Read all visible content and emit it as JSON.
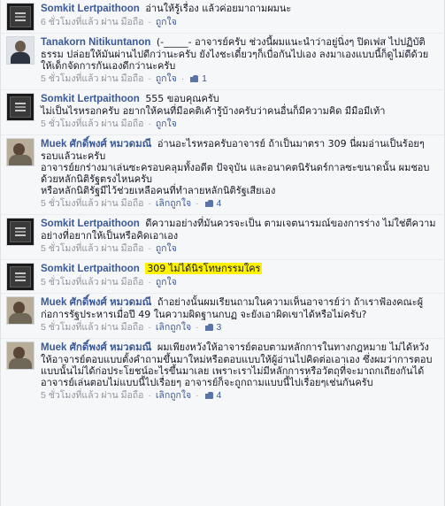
{
  "comments": [
    {
      "author": "Somkit Lertpaithoon",
      "avatar": "somkit",
      "text": "อ่านให้รู้เรื่อง แล้วค่อยมาถามผมนะ",
      "time": "6 ชั่วโมงที่แล้ว",
      "via": "ผ่าน มือถือ",
      "action": "ถูกใจ",
      "likes": "",
      "highlight": false
    },
    {
      "author": "Tanakorn Nitikuntanon",
      "avatar": "tanakorn",
      "text": "(-_____- อาจารย์ครับ ช่วงนี้ผมแนะนำว่าอยู่นิ่งๆ ปิดเฟส ไปปฏิบัติธรรม ปล่อยให้มันผ่านไปดีกว่านะครับ ยังไงชะเดี๋ยวๆก็เบื่อกันไปเอง ลงมาเองแบบนี้ก็ดูไม่ดีด้วย ให้เด็กจัดการกันเองดีกว่านะครับ",
      "time": "5 ชั่วโมงที่แล้ว",
      "via": "ผ่าน มือถือ",
      "action": "ถูกใจ",
      "likes": "1",
      "highlight": false
    },
    {
      "author": "Somkit Lertpaithoon",
      "avatar": "somkit",
      "text": "555 ขอบคุณครับ\nไม่เป็นไรหรอกครับ อยากให้คนที่มีอคติเค้ารู้บ้างครับว่าคนอื่นก็มีความคิด มีมือมีเท้า",
      "time": "5 ชั่วโมงที่แล้ว",
      "via": "ผ่าน มือถือ",
      "action": "ถูกใจ",
      "likes": "",
      "highlight": false
    },
    {
      "author": "Muek ศักดิ์พงศ์ หมวดมณี",
      "avatar": "muek",
      "text": "อ่านอะไรหรอครับอาจารย์ ถ้าเป็นมาตรา 309 นี่ผมอ่านเป็นร้อยๆรอบแล้วนะครับ\nอาจารย์ยกร่างมาเล่นซะครอบคลุมทั้งอดีต ปัจจุบัน และอนาคตนิรันดร์กาลซะขนาดนั้น ผมชอบด้วยหลักนิติรัฐตรงไหนครับ\nหรือหลักนิติรัฐมีไว้ช่วยเหลือคนที่ทำลายหลักนิติรัฐเสียเอง",
      "time": "5 ชั่วโมงที่แล้ว",
      "via": "ผ่าน มือถือ",
      "action": "เลิกถูกใจ",
      "likes": "4",
      "highlight": false
    },
    {
      "author": "Somkit Lertpaithoon",
      "avatar": "somkit",
      "text": "ดีความอย่างที่มันควรจะเป็น ตามเจตนารมณ์ของการร่าง ไม่ใช่ตีความอย่างที่อยากให้เป็นหรือคิดเอาเอง",
      "time": "5 ชั่วโมงที่แล้ว",
      "via": "ผ่าน มือถือ",
      "action": "ถูกใจ",
      "likes": "",
      "highlight": false
    },
    {
      "author": "Somkit Lertpaithoon",
      "avatar": "somkit",
      "text": "309 ไม่ได้นิรโทษกรรมใคร",
      "time": "5 ชั่วโมงที่แล้ว",
      "via": "ผ่าน มือถือ",
      "action": "ถูกใจ",
      "likes": "",
      "highlight": true
    },
    {
      "author": "Muek ศักดิ์พงศ์ หมวดมณี",
      "avatar": "muek",
      "text": "ถ้าอย่างนั้นผมเรียนถามในความเห็นอาจารย์ว่า ถ้าเราฟ้องคณะผู้ก่อการรัฐประหารเมื่อปี 49 ในความผิดฐานกบฏ จะยังเอาผิดเขาได้หรือไม่ครับ?",
      "time": "5 ชั่วโมงที่แล้ว",
      "via": "ผ่าน มือถือ",
      "action": "เลิกถูกใจ",
      "likes": "3",
      "highlight": false
    },
    {
      "author": "Muek ศักดิ์พงศ์ หมวดมณี",
      "avatar": "muek",
      "text": "ผมเพียงหวังให้อาจารย์ตอบตามหลักการในทางกฎหมาย ไม่ได้หวังให้อาจารย์ตอบแบบตั้งคำถามขึ้นมาใหม่หรือตอบแบบให้ผู้อ่านไปคิดต่อเอาเอง ซึ่งผมว่าการตอบแบบนั้นไม่ได้ก่อประโยชน์อะไรขึ้นมาเลย เพราะเราไม่มีหลักการหรือวัตถุที่จะมาถกเถียงกันได้\nอาจารย์เล่นตอบไม่แบบนี้ไปเรื่อยๆ อาจารย์ก็จะถูกถามแบบนี้ไปเรื่อยๆเช่นกันครับ",
      "time": "5 ชั่วโมงที่แล้ว",
      "via": "ผ่าน มือถือ",
      "action": "เลิกถูกใจ",
      "likes": "4",
      "highlight": false
    }
  ]
}
